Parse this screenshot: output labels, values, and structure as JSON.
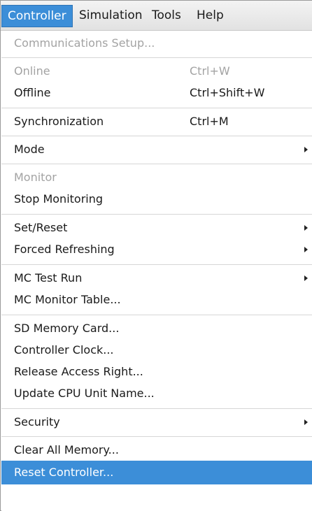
{
  "menubar": {
    "items": [
      {
        "label": "Controller"
      },
      {
        "label": "Simulation"
      },
      {
        "label": "Tools"
      },
      {
        "label": "Help"
      }
    ]
  },
  "menu": {
    "items": [
      {
        "label": "Communications Setup...",
        "shortcut": "",
        "disabled": true
      },
      {
        "label": "Online",
        "shortcut": "Ctrl+W",
        "disabled": true
      },
      {
        "label": "Offline",
        "shortcut": "Ctrl+Shift+W"
      },
      {
        "label": "Synchronization",
        "shortcut": "Ctrl+M"
      },
      {
        "label": "Mode",
        "submenu": true
      },
      {
        "label": "Monitor",
        "disabled": true
      },
      {
        "label": "Stop Monitoring"
      },
      {
        "label": "Set/Reset",
        "submenu": true
      },
      {
        "label": "Forced Refreshing",
        "submenu": true
      },
      {
        "label": "MC Test Run",
        "submenu": true
      },
      {
        "label": "MC Monitor Table..."
      },
      {
        "label": "SD Memory Card..."
      },
      {
        "label": "Controller Clock..."
      },
      {
        "label": "Release Access Right..."
      },
      {
        "label": "Update CPU Unit Name..."
      },
      {
        "label": "Security",
        "submenu": true
      },
      {
        "label": "Clear All Memory..."
      },
      {
        "label": "Reset Controller...",
        "highlighted": true
      }
    ]
  },
  "colors": {
    "highlight": "#3c8ed8",
    "disabled_text": "#a3a3a3",
    "separator": "#d6d6d6"
  }
}
